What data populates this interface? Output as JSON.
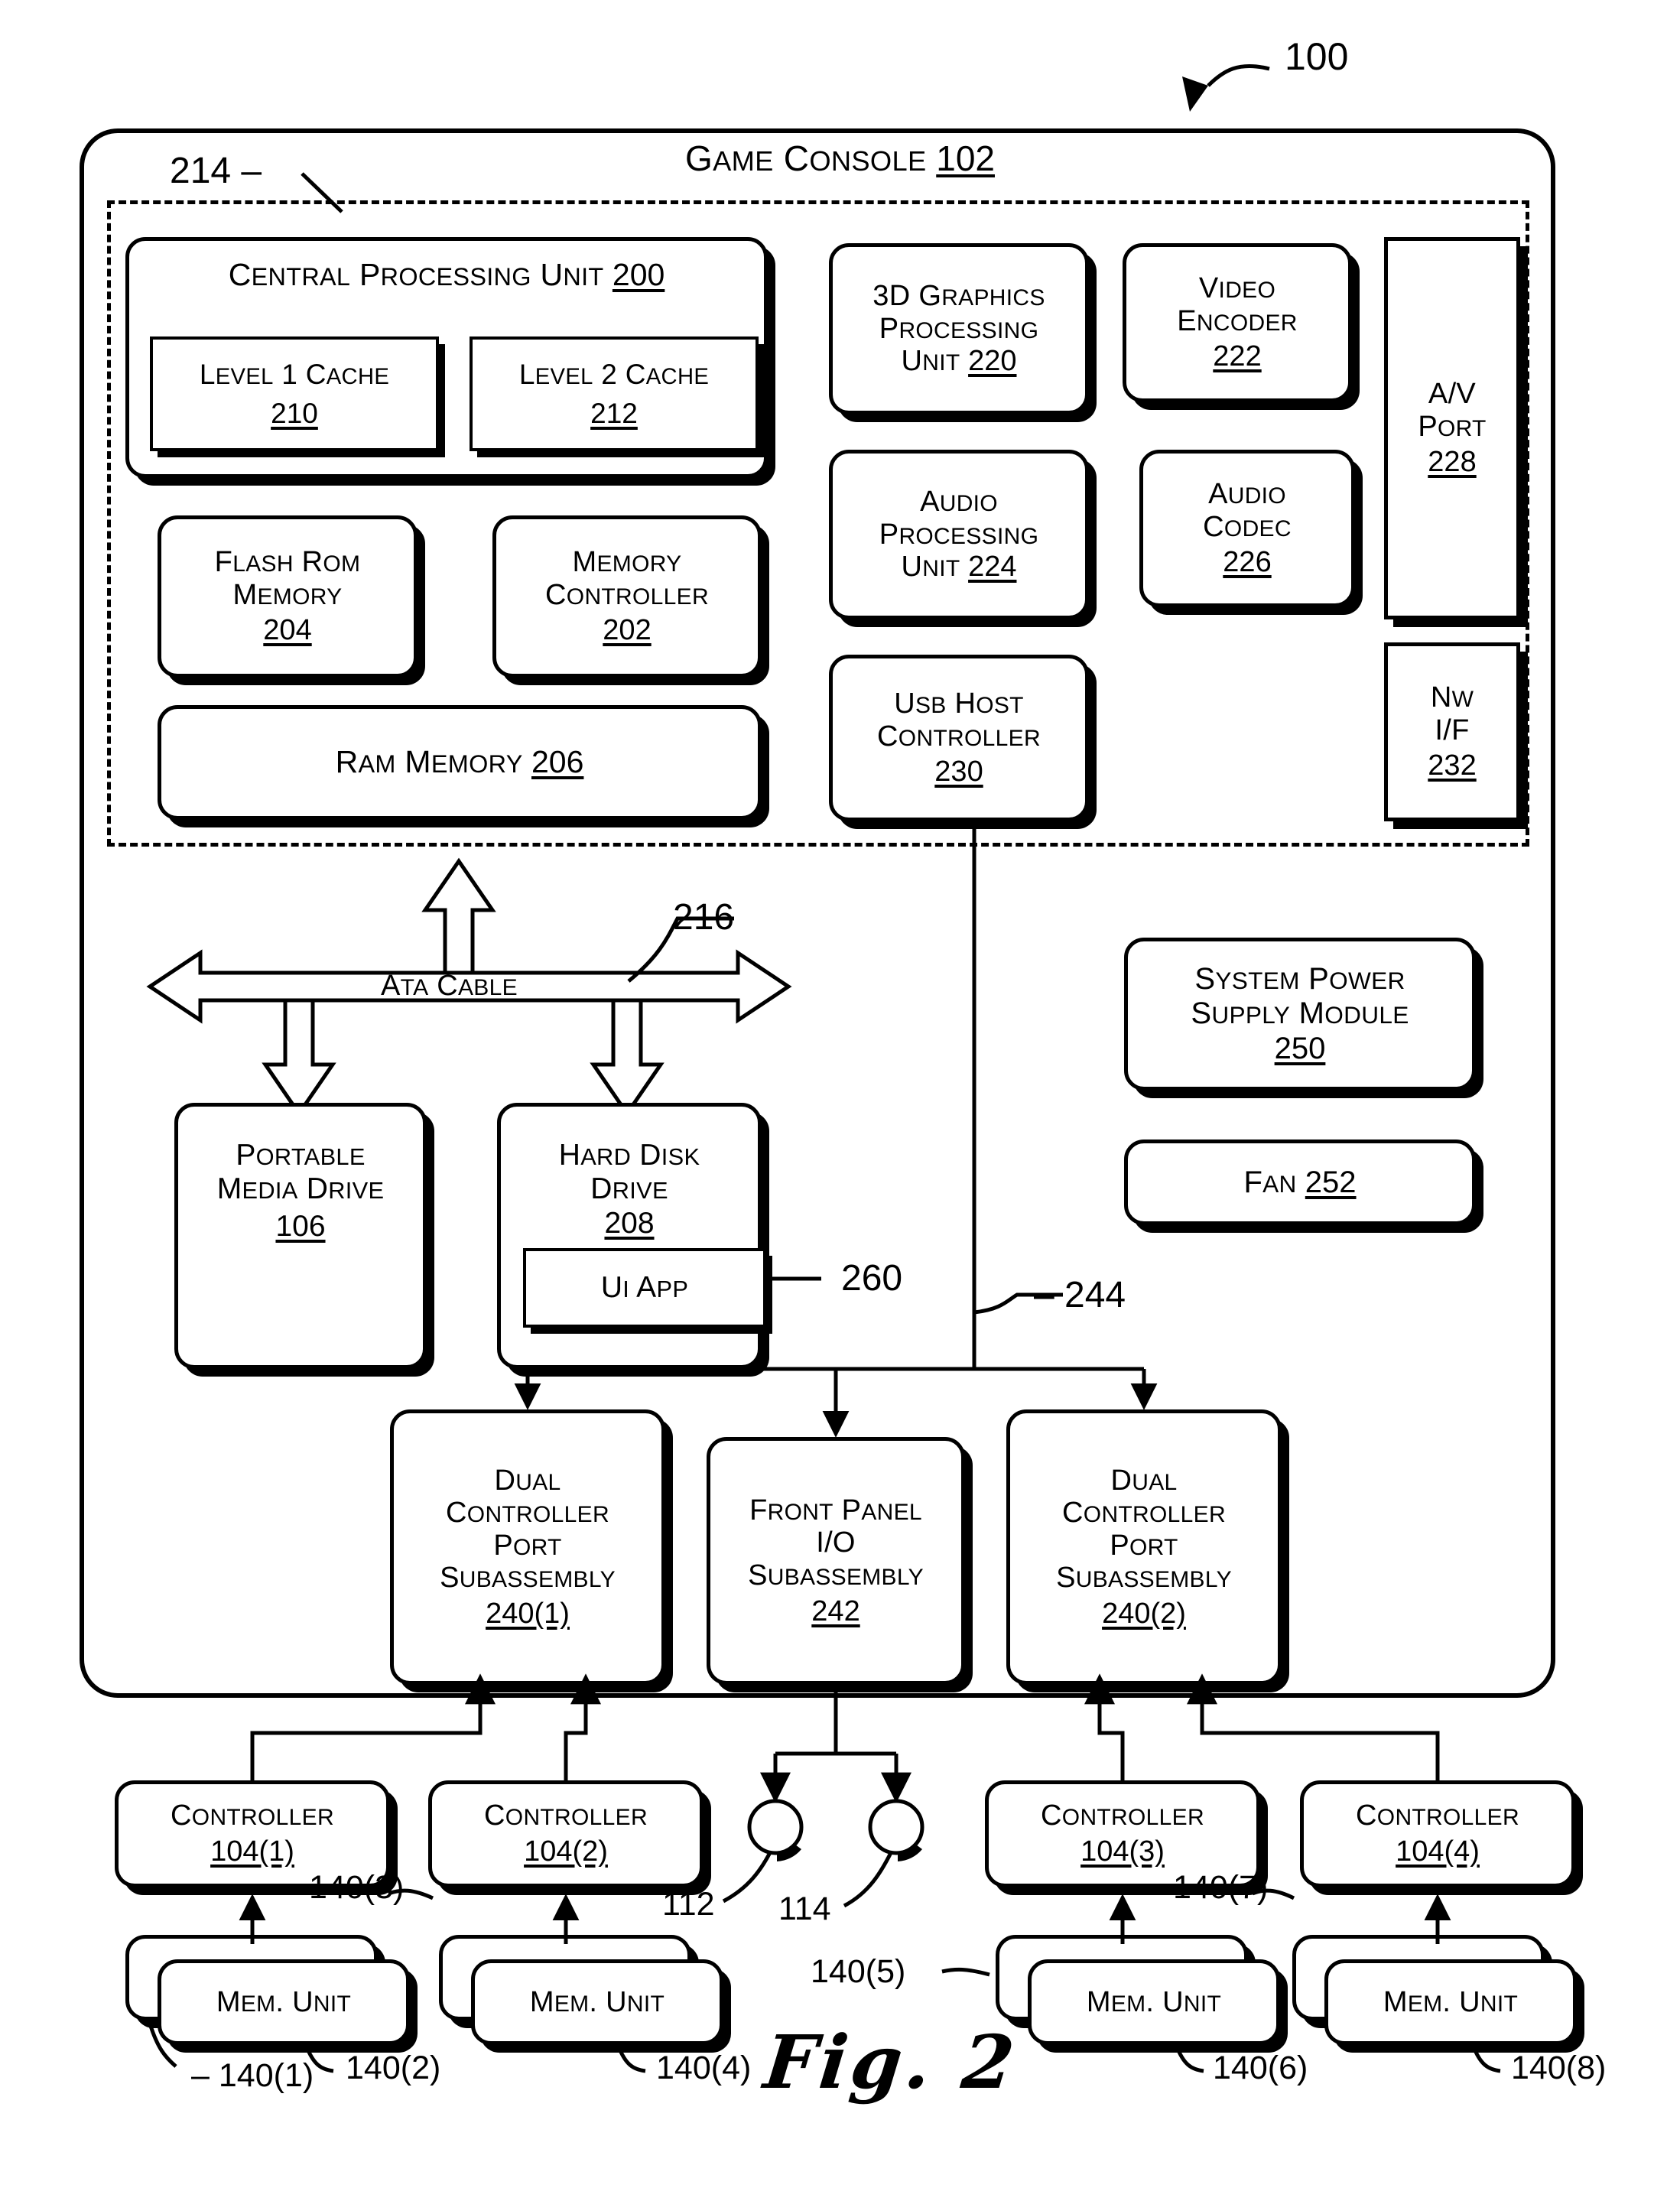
{
  "figure": {
    "caption": "Fig. 2",
    "system_ref": "100"
  },
  "console": {
    "title_text": "Game Console",
    "title_ref": "102",
    "dashed_region_ref": "214"
  },
  "blocks": {
    "cpu": {
      "line1": "Central Processing Unit",
      "ref": "200"
    },
    "l1cache": {
      "line1": "Level 1 Cache",
      "ref": "210"
    },
    "l2cache": {
      "line1": "Level 2 Cache",
      "ref": "212"
    },
    "flashrom": {
      "line1": "Flash ROM",
      "line2": "Memory",
      "ref": "204"
    },
    "memctrl": {
      "line1": "Memory",
      "line2": "Controller",
      "ref": "202"
    },
    "ram": {
      "line1": "RAM Memory",
      "ref": "206"
    },
    "gpu": {
      "line1": "3D Graphics",
      "line2": "Processing",
      "line3": "Unit",
      "ref": "220"
    },
    "videoenc": {
      "line1": "Video",
      "line2": "Encoder",
      "ref": "222"
    },
    "apu": {
      "line1": "Audio",
      "line2": "Processing",
      "line3": "Unit",
      "ref": "224"
    },
    "audiocodec": {
      "line1": "Audio",
      "line2": "Codec",
      "ref": "226"
    },
    "usbhost": {
      "line1": "USB Host",
      "line2": "Controller",
      "ref": "230"
    },
    "avport": {
      "line1": "A/V",
      "line2": "Port",
      "ref": "228"
    },
    "nwif": {
      "line1": "NW",
      "line2": "I/F",
      "ref": "232"
    },
    "ata": {
      "label": "ATA Cable",
      "ref": "216"
    },
    "portable": {
      "line1": "Portable",
      "line2": "Media Drive",
      "ref": "106"
    },
    "harddisk": {
      "line1": "Hard Disk",
      "line2": "Drive",
      "ref": "208"
    },
    "uiapp": {
      "line1": "UI App",
      "ref": "260"
    },
    "psu": {
      "line1": "System Power",
      "line2": "Supply Module",
      "ref": "250"
    },
    "fan": {
      "line1": "Fan",
      "ref": "252"
    },
    "dcps1": {
      "line1": "Dual",
      "line2": "Controller",
      "line3": "Port",
      "line4": "Subassembly",
      "ref": "240(1)"
    },
    "frontpanel": {
      "line1": "Front Panel",
      "line2": "I/O",
      "line3": "Subassembly",
      "ref": "242"
    },
    "dcps2": {
      "line1": "Dual",
      "line2": "Controller",
      "line3": "Port",
      "line4": "Subassembly",
      "ref": "240(2)"
    },
    "controller1": {
      "line1": "Controller",
      "ref": "104(1)"
    },
    "controller2": {
      "line1": "Controller",
      "ref": "104(2)"
    },
    "controller3": {
      "line1": "Controller",
      "ref": "104(3)"
    },
    "controller4": {
      "line1": "Controller",
      "ref": "104(4)"
    },
    "memunit1": {
      "line1": "Mem. Unit"
    },
    "memunit2": {
      "line1": "Mem. Unit"
    },
    "memunit3": {
      "line1": "Mem. Unit"
    },
    "memunit4": {
      "line1": "Mem. Unit"
    }
  },
  "refs": {
    "bus244": "244",
    "mem140_1": "140(1)",
    "mem140_2": "140(2)",
    "mem140_3": "140(3)",
    "mem140_4": "140(4)",
    "mem140_5": "140(5)",
    "mem140_6": "140(6)",
    "mem140_7": "140(7)",
    "mem140_8": "140(8)",
    "port112": "112",
    "port114": "114"
  }
}
